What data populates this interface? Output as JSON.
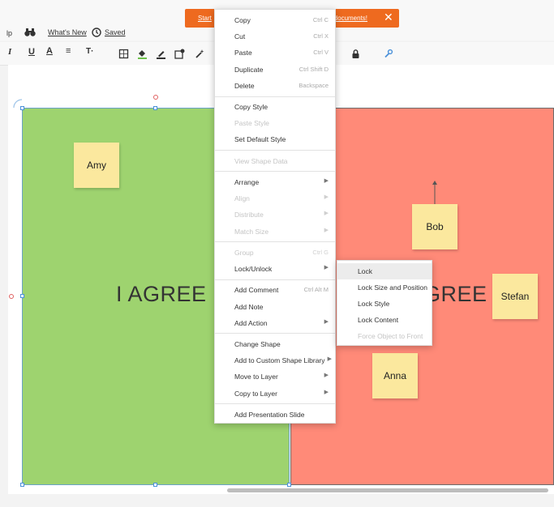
{
  "menubar": {
    "help_label": "lp",
    "whats_new_label": "What's New",
    "saved_label": "Saved"
  },
  "banner": {
    "start_text": "Start",
    "docs_text": "d documents!",
    "close_glyph": "✕"
  },
  "toolbar": {
    "italic": "I",
    "underline": "U",
    "text_color": "A",
    "align": "≡",
    "text_size": "T·"
  },
  "canvas": {
    "left_text": "I AGREE",
    "right_text": "GREE",
    "colors": {
      "green": "#9ed36f",
      "red": "#ff8a78",
      "note": "#fbe89e"
    },
    "notes": [
      "Amy",
      "Bob",
      "Stefan",
      "Anna"
    ]
  },
  "context_menu": {
    "items": [
      {
        "label": "Copy",
        "shortcut": "Ctrl C"
      },
      {
        "label": "Cut",
        "shortcut": "Ctrl X"
      },
      {
        "label": "Paste",
        "shortcut": "Ctrl V"
      },
      {
        "label": "Duplicate",
        "shortcut": "Ctrl Shift D"
      },
      {
        "label": "Delete",
        "shortcut": "Backspace"
      },
      {
        "label": "Copy Style"
      },
      {
        "label": "Paste Style"
      },
      {
        "label": "Set Default Style"
      },
      {
        "label": "View Shape Data"
      },
      {
        "label": "Arrange"
      },
      {
        "label": "Align"
      },
      {
        "label": "Distribute"
      },
      {
        "label": "Match Size"
      },
      {
        "label": "Group",
        "shortcut": "Ctrl G"
      },
      {
        "label": "Lock/Unlock"
      },
      {
        "label": "Add Comment",
        "shortcut": "Ctrl Alt M"
      },
      {
        "label": "Add Note"
      },
      {
        "label": "Add Action"
      },
      {
        "label": "Change Shape"
      },
      {
        "label": "Add to Custom Shape Library"
      },
      {
        "label": "Move to Layer"
      },
      {
        "label": "Copy to Layer"
      },
      {
        "label": "Add Presentation Slide"
      }
    ]
  },
  "submenu": {
    "items": [
      {
        "label": "Lock"
      },
      {
        "label": "Lock Size and Position"
      },
      {
        "label": "Lock Style"
      },
      {
        "label": "Lock Content"
      },
      {
        "label": "Force Object to Front"
      }
    ]
  }
}
